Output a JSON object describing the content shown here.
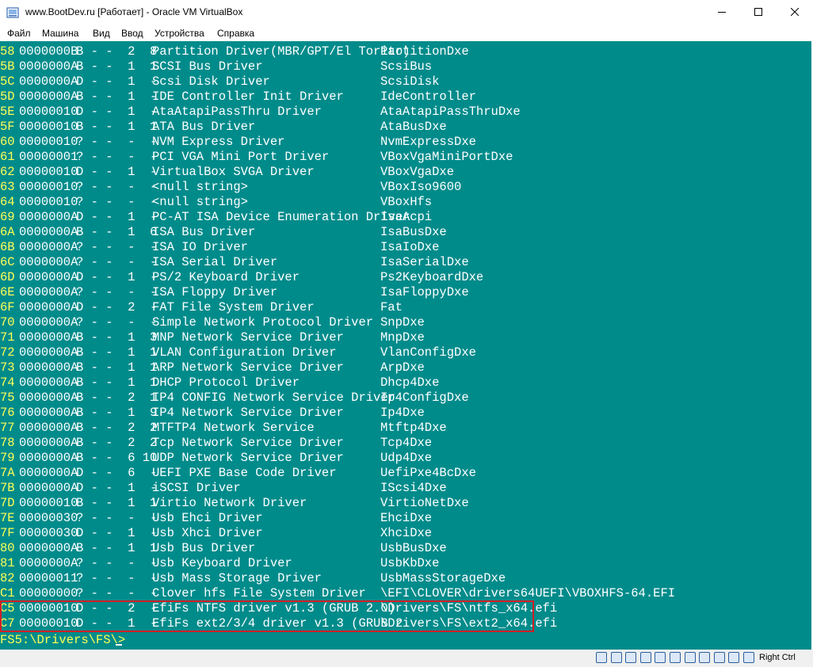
{
  "window": {
    "title": "www.BootDev.ru [Работает] - Oracle VM VirtualBox",
    "icon": "virtualbox-icon",
    "controls": [
      "minimize-icon",
      "maximize-icon",
      "close-icon"
    ]
  },
  "menu": [
    "Файл",
    "Машина",
    "Вид",
    "Ввод",
    "Устройства",
    "Справка"
  ],
  "console": {
    "background": "#008b8b",
    "text_color": "#ffffff",
    "highlight_color": "#ffff55",
    "rows": [
      [
        "58",
        "0000000B",
        "B - -  2  8",
        "Partition Driver(MBR/GPT/El Torito)",
        "PartitionDxe"
      ],
      [
        "5B",
        "0000000A",
        "B - -  1  1",
        "SCSI Bus Driver",
        "ScsiBus"
      ],
      [
        "5C",
        "0000000A",
        "D - -  1  -",
        "Scsi Disk Driver",
        "ScsiDisk"
      ],
      [
        "5D",
        "0000000A",
        "B - -  1  -",
        "IDE Controller Init Driver",
        "IdeController"
      ],
      [
        "5E",
        "00000010",
        "D - -  1  -",
        "AtaAtapiPassThru Driver",
        "AtaAtapiPassThruDxe"
      ],
      [
        "5F",
        "00000010",
        "B - -  1  1",
        "ATA Bus Driver",
        "AtaBusDxe"
      ],
      [
        "60",
        "00000010",
        "? - -  -  -",
        "NVM Express Driver",
        "NvmExpressDxe"
      ],
      [
        "61",
        "00000001",
        "? - -  -  -",
        "PCI VGA Mini Port Driver",
        "VBoxVgaMiniPortDxe"
      ],
      [
        "62",
        "00000010",
        "D - -  1  -",
        "VirtualBox SVGA Driver",
        "VBoxVgaDxe"
      ],
      [
        "63",
        "00000010",
        "? - -  -  -",
        "<null string>",
        "VBoxIso9600"
      ],
      [
        "64",
        "00000010",
        "? - -  -  -",
        "<null string>",
        "VBoxHfs"
      ],
      [
        "69",
        "0000000A",
        "D - -  1  -",
        "PC-AT ISA Device Enumeration Driver",
        "IsaAcpi"
      ],
      [
        "6A",
        "0000000A",
        "B - -  1  6",
        "ISA Bus Driver",
        "IsaBusDxe"
      ],
      [
        "6B",
        "0000000A",
        "? - -  -  -",
        "ISA IO Driver",
        "IsaIoDxe"
      ],
      [
        "6C",
        "0000000A",
        "? - -  -  -",
        "ISA Serial Driver",
        "IsaSerialDxe"
      ],
      [
        "6D",
        "0000000A",
        "D - -  1  -",
        "PS/2 Keyboard Driver",
        "Ps2KeyboardDxe"
      ],
      [
        "6E",
        "0000000A",
        "? - -  -  -",
        "ISA Floppy Driver",
        "IsaFloppyDxe"
      ],
      [
        "6F",
        "0000000A",
        "D - -  2  -",
        "FAT File System Driver",
        "Fat"
      ],
      [
        "70",
        "0000000A",
        "? - -  -  -",
        "Simple Network Protocol Driver",
        "SnpDxe"
      ],
      [
        "71",
        "0000000A",
        "B - -  1  3",
        "MNP Network Service Driver",
        "MnpDxe"
      ],
      [
        "72",
        "0000000A",
        "B - -  1  1",
        "VLAN Configuration Driver",
        "VlanConfigDxe"
      ],
      [
        "73",
        "0000000A",
        "B - -  1  1",
        "ARP Network Service Driver",
        "ArpDxe"
      ],
      [
        "74",
        "0000000A",
        "B - -  1  1",
        "DHCP Protocol Driver",
        "Dhcp4Dxe"
      ],
      [
        "75",
        "0000000A",
        "B - -  2  1",
        "IP4 CONFIG Network Service Driver",
        "Ip4ConfigDxe"
      ],
      [
        "76",
        "0000000A",
        "B - -  1  9",
        "IP4 Network Service Driver",
        "Ip4Dxe"
      ],
      [
        "77",
        "0000000A",
        "B - -  2  2",
        "MTFTP4 Network Service",
        "Mtftp4Dxe"
      ],
      [
        "78",
        "0000000A",
        "B - -  2  2",
        "Tcp Network Service Driver",
        "Tcp4Dxe"
      ],
      [
        "79",
        "0000000A",
        "B - -  6 10",
        "UDP Network Service Driver",
        "Udp4Dxe"
      ],
      [
        "7A",
        "0000000A",
        "D - -  6  -",
        "UEFI PXE Base Code Driver",
        "UefiPxe4BcDxe"
      ],
      [
        "7B",
        "0000000A",
        "D - -  1  -",
        "iSCSI Driver",
        "IScsi4Dxe"
      ],
      [
        "7D",
        "00000010",
        "B - -  1  1",
        "Virtio Network Driver",
        "VirtioNetDxe"
      ],
      [
        "7E",
        "00000030",
        "? - -  -  -",
        "Usb Ehci Driver",
        "EhciDxe"
      ],
      [
        "7F",
        "00000030",
        "D - -  1  -",
        "Usb Xhci Driver",
        "XhciDxe"
      ],
      [
        "80",
        "0000000A",
        "B - -  1  1",
        "Usb Bus Driver",
        "UsbBusDxe"
      ],
      [
        "81",
        "0000000A",
        "? - -  -  -",
        "Usb Keyboard Driver",
        "UsbKbDxe"
      ],
      [
        "82",
        "00000011",
        "? - -  -  -",
        "Usb Mass Storage Driver",
        "UsbMassStorageDxe"
      ],
      [
        "C1",
        "00000000",
        "? - -  -  -",
        "Clover hfs File System Driver",
        "\\EFI\\CLOVER\\drivers64UEFI\\VBOXHFS-64.EFI"
      ],
      [
        "C5",
        "00000010",
        "D - -  2  -",
        "EfiFs NTFS driver v1.3 (GRUB 2.0)",
        "\\Drivers\\FS\\ntfs_x64.efi"
      ],
      [
        "C7",
        "00000010",
        "D - -  1  -",
        "EfiFs ext2/3/4 driver v1.3 (GRUB 2.",
        "\\Drivers\\FS\\ext2_x64.efi"
      ]
    ],
    "prompt": "FS5:\\Drivers\\FS\\>"
  },
  "status_bar": {
    "icons": [
      "hard-disk-icon",
      "optical-disk-icon",
      "audio-icon",
      "network-icon",
      "usb-icon",
      "shared-folders-icon",
      "display-icon",
      "video-capture-icon",
      "cpu-icon",
      "mouse-integration-icon",
      "keyboard-icon"
    ],
    "host_key": "Right Ctrl"
  }
}
